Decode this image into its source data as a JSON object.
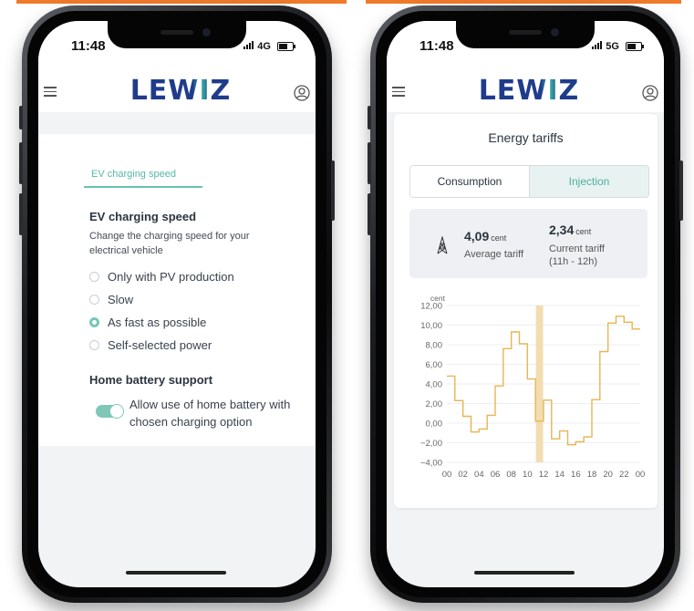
{
  "left_phone": {
    "status": {
      "time": "11:48",
      "network": "4G"
    },
    "logo_text": "LEWIZ",
    "tab": "EV charging speed",
    "section1_title": "EV charging speed",
    "section1_desc": "Change the charging speed for your electrical vehicle",
    "options": [
      {
        "label": "Only with PV production",
        "selected": false
      },
      {
        "label": "Slow",
        "selected": false
      },
      {
        "label": "As fast as possible",
        "selected": true
      },
      {
        "label": "Self-selected power",
        "selected": false
      }
    ],
    "section2_title": "Home battery support",
    "toggle_label": "Allow use of home battery with chosen charging option",
    "toggle_on": true
  },
  "right_phone": {
    "status": {
      "time": "11:48",
      "network": "5G"
    },
    "logo_text": "LEWIZ",
    "card_title": "Energy tariffs",
    "tabs": [
      "Consumption",
      "Injection"
    ],
    "active_tab": "Injection",
    "average": {
      "value": "4,09",
      "unit": "cent",
      "label": "Average tariff"
    },
    "current": {
      "value": "2,34",
      "unit": "cent",
      "label_line1": "Current tariff",
      "label_line2": "(11h - 12h)"
    }
  },
  "colors": {
    "accent_orange": "#f07a2a",
    "teal": "#68c2b0",
    "line": "#e6b655",
    "highlight": "#f3ddb0"
  },
  "chart_data": {
    "type": "line",
    "title": "",
    "ylabel": "cent",
    "xlabel": "",
    "ylim": [
      -4,
      12
    ],
    "yticks": [
      "12,00",
      "10,00",
      "8,00",
      "6,00",
      "4,00",
      "2,00",
      "0,00",
      "−2,00",
      "−4,00"
    ],
    "xticks": [
      "00",
      "02",
      "04",
      "06",
      "08",
      "10",
      "12",
      "14",
      "16",
      "18",
      "20",
      "22",
      "00"
    ],
    "step": true,
    "highlight_hour": 11,
    "series": [
      {
        "values": [
          4.8,
          2.3,
          0.7,
          -0.9,
          -0.6,
          0.8,
          3.8,
          7.6,
          9.3,
          8.1,
          4.5,
          0.2,
          2.34,
          -1.6,
          -0.8,
          -2.2,
          -1.9,
          -1.4,
          2.4,
          7.3,
          10.2,
          10.9,
          10.3,
          9.6
        ]
      }
    ]
  }
}
